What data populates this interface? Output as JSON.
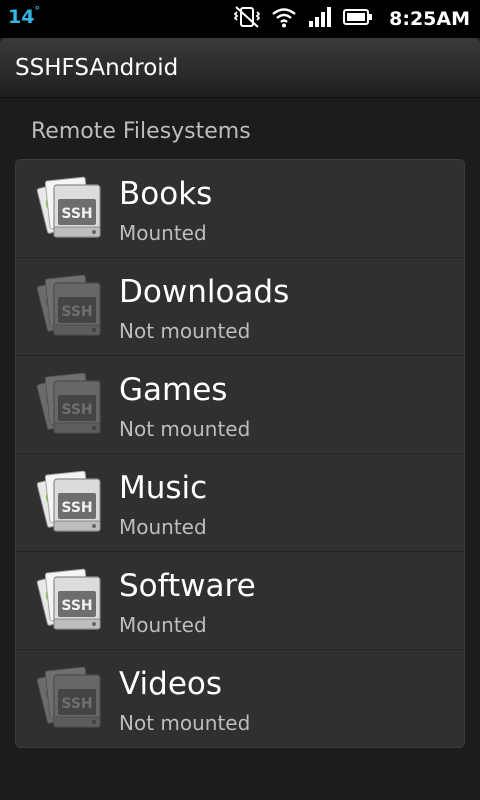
{
  "status_bar": {
    "temperature": "14",
    "degree": "°",
    "time": "8:25AM"
  },
  "app": {
    "title": "SSHFSAndroid"
  },
  "section": {
    "header": "Remote Filesystems"
  },
  "icon": {
    "badge_text": "SSH"
  },
  "filesystems": [
    {
      "name": "Books",
      "status": "Mounted",
      "mounted": true
    },
    {
      "name": "Downloads",
      "status": "Not mounted",
      "mounted": false
    },
    {
      "name": "Games",
      "status": "Not mounted",
      "mounted": false
    },
    {
      "name": "Music",
      "status": "Mounted",
      "mounted": true
    },
    {
      "name": "Software",
      "status": "Mounted",
      "mounted": true
    },
    {
      "name": "Videos",
      "status": "Not mounted",
      "mounted": false
    }
  ],
  "colors": {
    "status_accent": "#33b5e5",
    "android_green": "#8dc63f"
  }
}
